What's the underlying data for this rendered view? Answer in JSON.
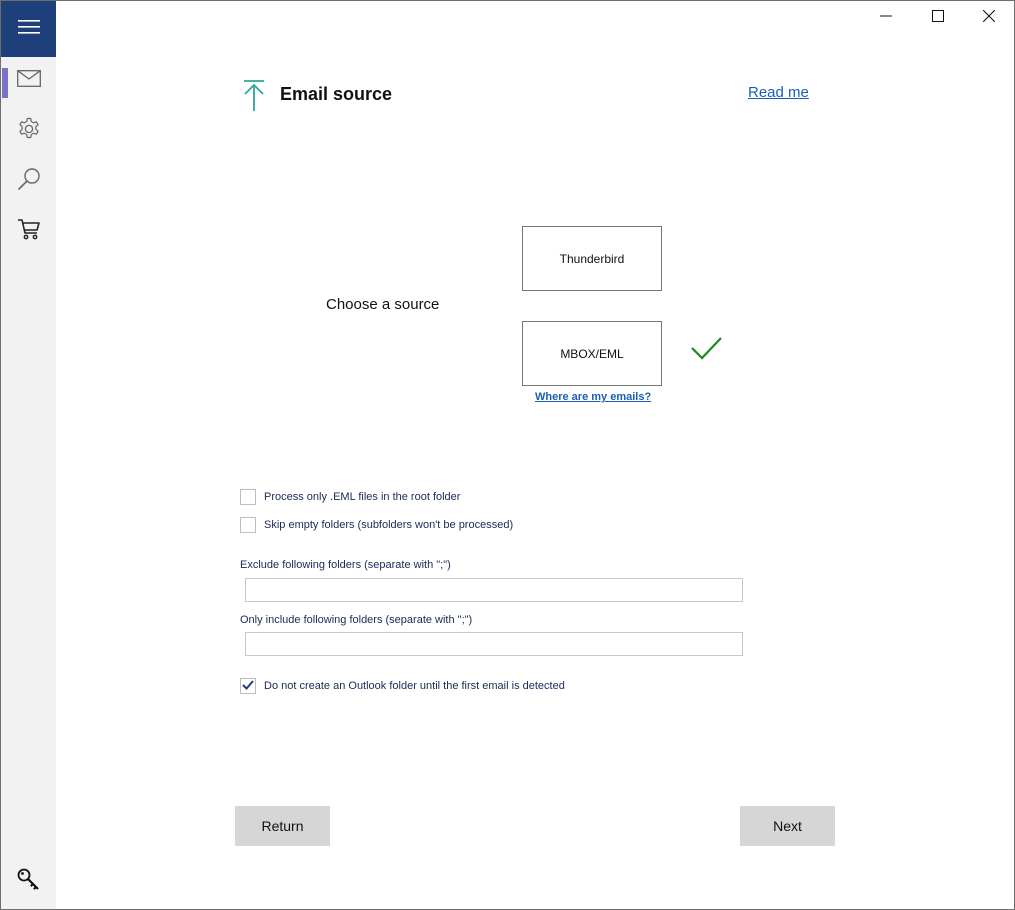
{
  "window": {
    "controls": {
      "minimize": "minimize-icon",
      "maximize": "maximize-icon",
      "close": "close-icon"
    }
  },
  "sidebar": {
    "menu_icon": "hamburger-icon",
    "items": [
      {
        "name": "mail",
        "icon": "mail-icon",
        "active": true
      },
      {
        "name": "settings",
        "icon": "gear-icon",
        "active": false
      },
      {
        "name": "search",
        "icon": "search-icon",
        "active": false
      },
      {
        "name": "cart",
        "icon": "cart-icon",
        "active": false
      }
    ],
    "bottom_icon": "key-icon",
    "accent_color": "#1f3f7a",
    "active_indicator_color": "#7a72c8"
  },
  "header": {
    "icon": "upload-arrow-icon",
    "title": "Email source",
    "read_me": "Read me",
    "accent_color": "#2aa89a"
  },
  "source": {
    "label": "Choose a source",
    "options": [
      {
        "label": "Thunderbird",
        "selected": false
      },
      {
        "label": "MBOX/EML",
        "selected": true
      }
    ],
    "selected_icon": "checkmark-icon",
    "help_link": "Where are my emails?"
  },
  "options": {
    "eml_root_only": {
      "label": "Process only .EML files in the root folder",
      "checked": false
    },
    "skip_empty": {
      "label": "Skip empty folders (subfolders won't be processed)",
      "checked": false
    },
    "exclude_folders": {
      "label": "Exclude following folders (separate with \";\")",
      "value": ""
    },
    "include_folders": {
      "label": "Only include following folders (separate with \";\")",
      "value": ""
    },
    "no_create_until_email": {
      "label": "Do not create an Outlook folder until the first email is detected",
      "checked": true
    }
  },
  "footer": {
    "return_label": "Return",
    "next_label": "Next"
  }
}
